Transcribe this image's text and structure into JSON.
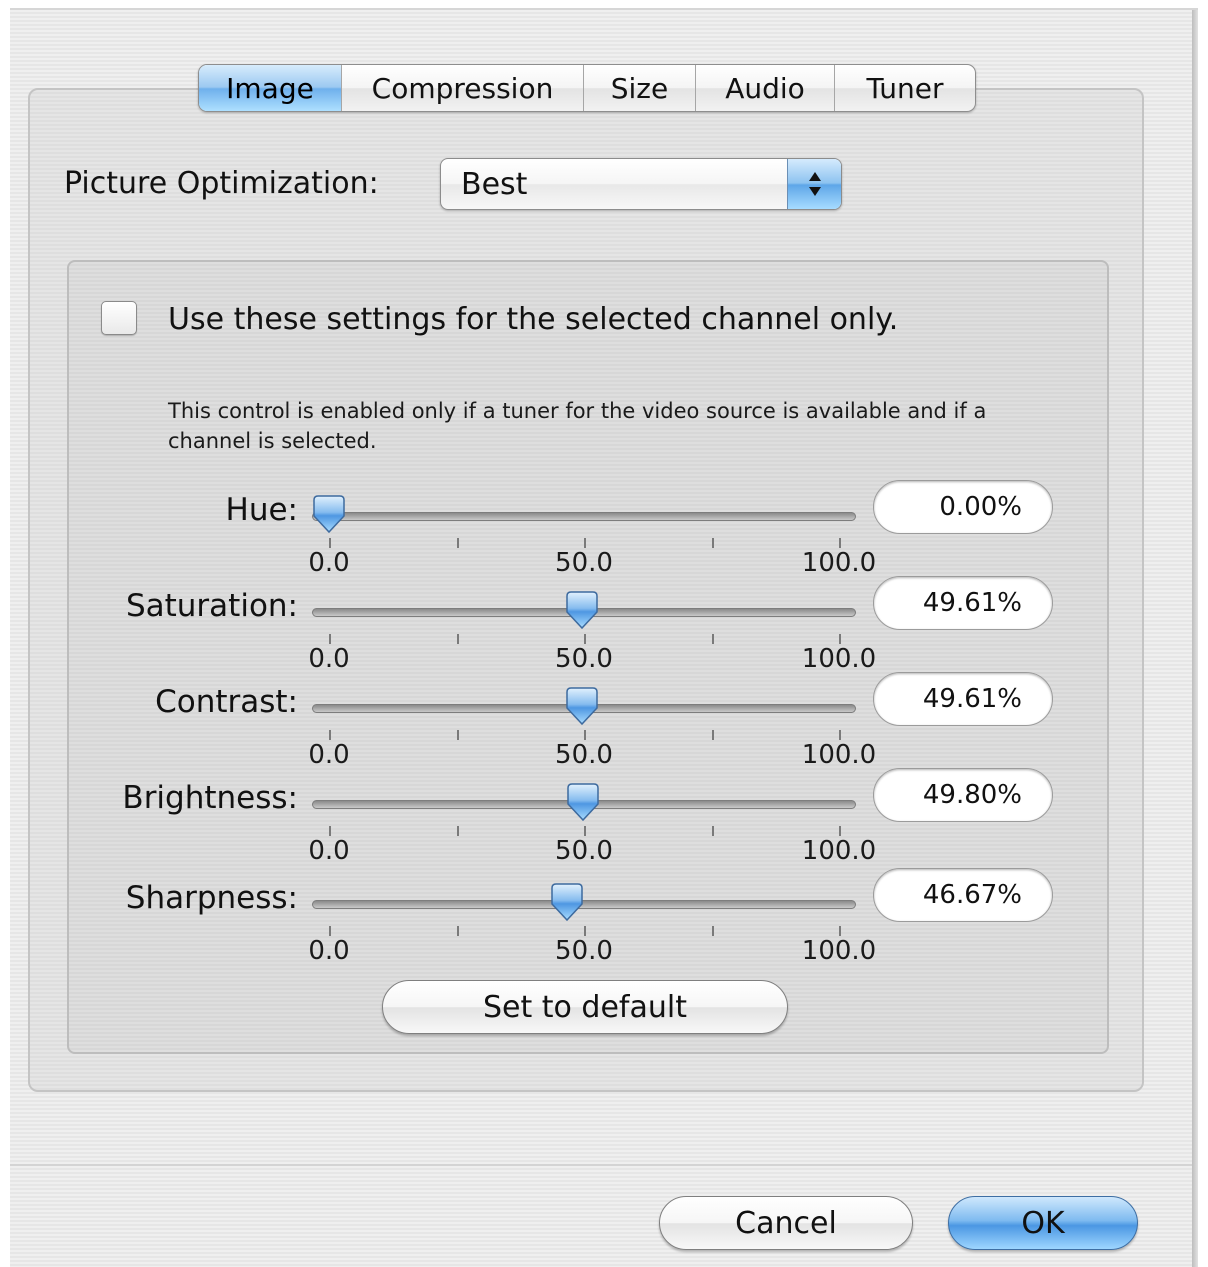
{
  "tabs": [
    "Image",
    "Compression",
    "Size",
    "Audio",
    "Tuner"
  ],
  "active_tab": "Image",
  "picture_optimization": {
    "label": "Picture Optimization:",
    "value": "Best"
  },
  "channel_checkbox": {
    "label": "Use these settings for the selected channel only.",
    "checked": false
  },
  "note": "This control is enabled only if a tuner for the video source is available and if a channel is selected.",
  "sliders": [
    {
      "label": "Hue:",
      "value": 0.0,
      "display": "0.00%",
      "min_label": "0.0",
      "mid_label": "50.0",
      "max_label": "100.0"
    },
    {
      "label": "Saturation:",
      "value": 49.61,
      "display": "49.61%",
      "min_label": "0.0",
      "mid_label": "50.0",
      "max_label": "100.0"
    },
    {
      "label": "Contrast:",
      "value": 49.61,
      "display": "49.61%",
      "min_label": "0.0",
      "mid_label": "50.0",
      "max_label": "100.0"
    },
    {
      "label": "Brightness:",
      "value": 49.8,
      "display": "49.80%",
      "min_label": "0.0",
      "mid_label": "50.0",
      "max_label": "100.0"
    },
    {
      "label": "Sharpness:",
      "value": 46.67,
      "display": "46.67%",
      "min_label": "0.0",
      "mid_label": "50.0",
      "max_label": "100.0"
    }
  ],
  "buttons": {
    "set_default": "Set to default",
    "cancel": "Cancel",
    "ok": "OK"
  },
  "colors": {
    "accent_blue": "#6fb0ec",
    "window_bg": "#ececec"
  }
}
